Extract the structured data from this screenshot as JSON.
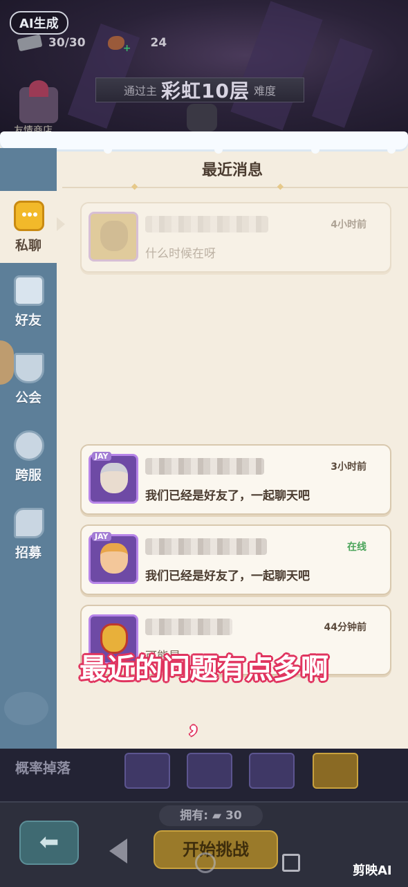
{
  "header": {
    "ai_badge": "AI生成",
    "stamina": "30/30",
    "food_count": "24",
    "banner_prefix": "通过主",
    "banner_highlight": "彩虹10层",
    "banner_suffix": "难度",
    "shop_label": "友情商店"
  },
  "panel": {
    "title": "最近消息"
  },
  "sidebar": {
    "items": [
      {
        "label": "私聊",
        "icon": "chat-bubble-icon",
        "active": true
      },
      {
        "label": "好友",
        "icon": "friends-icon",
        "active": false
      },
      {
        "label": "公会",
        "icon": "guild-shield-icon",
        "active": false
      },
      {
        "label": "跨服",
        "icon": "planet-icon",
        "active": false
      },
      {
        "label": "招募",
        "icon": "handshake-icon",
        "active": false
      }
    ]
  },
  "messages": [
    {
      "time": "4小时前",
      "text": "什么时候在呀",
      "faded": true,
      "online": false
    },
    {
      "time": "3小时前",
      "text": "我们已经是好友了，一起聊天吧",
      "faded": false,
      "online": false
    },
    {
      "time": "在线",
      "text": "我们已经是好友了，一起聊天吧",
      "faded": false,
      "online": true
    },
    {
      "time": "44分钟前",
      "text": "可能是",
      "faded": false,
      "online": false
    }
  ],
  "subtitle": {
    "line": "最近的问题有点多啊",
    "punct": "，"
  },
  "bottom": {
    "drop_label": "概率掉落",
    "own_label": "拥有:",
    "own_count": "30",
    "start_button": "开始挑战"
  },
  "watermark": "剪映AI",
  "colors": {
    "panel_bg": "#f4ede0",
    "sidebar_bg": "#5d7f99",
    "online_green": "#4aa45a",
    "subtitle_outline": "#e0345f"
  }
}
